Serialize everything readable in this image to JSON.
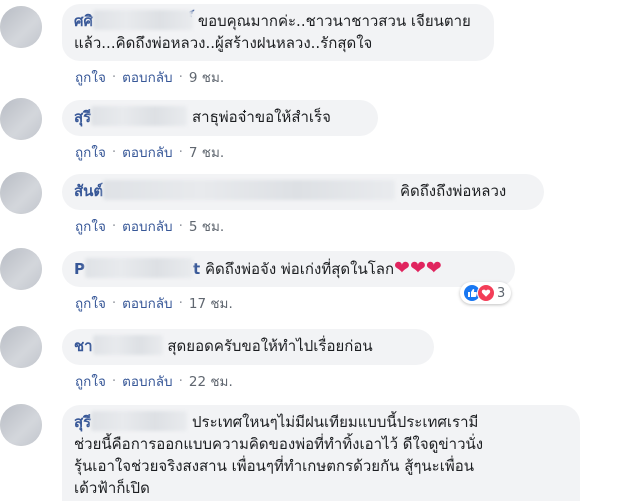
{
  "comments": [
    {
      "name": "ศศิ",
      "name_tail": "ิ์",
      "text_line1": "ขอบคุณมากค่ะ..ชาวนาชาวสวน เจียนตาย",
      "text_line2": "แล้ว...คิดถึงพ่อหลวง..ผู้สร้างฝนหลวง..รักสุดใจ",
      "like": "ถูกใจ",
      "reply": "ตอบกลับ",
      "time": "9 ชม."
    },
    {
      "name": "สุรี",
      "text": "สาธุพ่อจ๋าขอให้สำเร็จ",
      "like": "ถูกใจ",
      "reply": "ตอบกลับ",
      "time": "7 ชม."
    },
    {
      "name": "สันต์",
      "text": "คิดถึงถึงพ่อหลวง",
      "like": "ถูกใจ",
      "reply": "ตอบกลับ",
      "time": "5 ชม."
    },
    {
      "name": "P",
      "name_tail": "t",
      "text": "คิดถึงพ่อจัง พ่อเก่งที่สุดในโลก",
      "hearts": "❤❤❤",
      "reaction_count": "3",
      "like": "ถูกใจ",
      "reply": "ตอบกลับ",
      "time": "17 ชม."
    },
    {
      "name": "ชา",
      "text": "สุดยอดครับขอให้ทำไปเรื่อยก่อน",
      "like": "ถูกใจ",
      "reply": "ตอบกลับ",
      "time": "22 ชม."
    },
    {
      "name": "สุรี",
      "text_line1": "ประเทศใหนๆไม่มีฝนเทียมแบบนี้ประเทศเรามี",
      "text_line2": "ช่วยนี้คือการออกแบบความคิดของพ่อที่ทำทิ้งเอาไว้ ดีใจดูข่าวนั่ง",
      "text_line3": "รุ้นเอาใจช่วยจริงสงสาน เพื่อนๆที่ทำเกษตกรด้วยกัน สู้ๆนะเพื่อน",
      "text_line4": "เด้วฟ้าก็เปิด"
    }
  ],
  "dot": "·",
  "colors": {
    "name": "#385898",
    "bubble": "#f2f3f5",
    "heart": "#e0245e",
    "like_blue": "#1877f2",
    "love_red": "#f33e58"
  }
}
